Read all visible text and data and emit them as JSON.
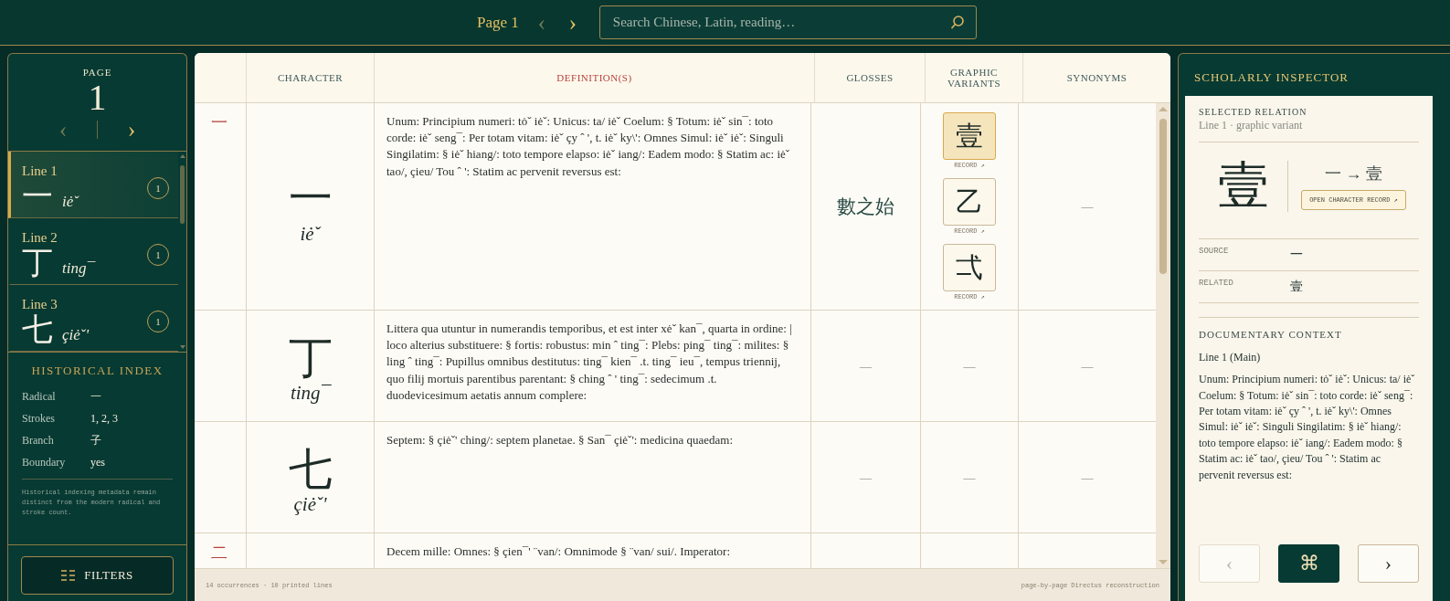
{
  "top_bar": {
    "page_label": "Page 1",
    "prev": {
      "label": "‹",
      "disabled": true
    },
    "next": {
      "label": "›",
      "disabled": false
    },
    "search": {
      "placeholder": "Search Chinese, Latin, reading…"
    }
  },
  "sidebar": {
    "page_caption": "PAGE",
    "page_number": "1",
    "prev": {
      "label": "‹",
      "disabled": true
    },
    "next": {
      "label": "›",
      "disabled": false
    },
    "lines": [
      {
        "label": "Line 1",
        "character": "一",
        "reading": "iėˇ",
        "count": "1",
        "selected": true
      },
      {
        "label": "Line 2",
        "character": "丁",
        "reading": "ting¯",
        "count": "1",
        "selected": false
      },
      {
        "label": "Line 3",
        "character": "七",
        "reading": "çiėˇ'",
        "count": "1",
        "selected": false
      }
    ],
    "index": {
      "title": "HISTORICAL INDEX",
      "fields": [
        {
          "label": "Radical",
          "value": "一"
        },
        {
          "label": "Strokes",
          "value": "1, 2, 3"
        },
        {
          "label": "Branch",
          "value": "子"
        },
        {
          "label": "Boundary",
          "value": "yes"
        }
      ],
      "note": "Historical indexing metadata remain distinct from the modern radical and stroke count."
    },
    "filters_button": "FILTERS"
  },
  "table": {
    "columns": [
      "",
      "CHARACTER",
      "DEFINITION(S)",
      "GLOSSES",
      "GRAPHIC VARIANTS",
      "SYNONYMS"
    ],
    "rows": [
      {
        "marker": "一",
        "character": "一",
        "reading": "iėˇ",
        "definition": "Unum: Principium numeri: tȯˇ iėˇ: Unicus: ta/ iėˇ Coelum: § Totum: iėˇ sin¯: toto corde: iėˇ seng¯: Per totam vitam: iėˇ çy ˆ ', t. iėˇ ky\\': Omnes Simul: iėˇ iėˇ: Singuli Singilatim: § iėˇ hiang/: toto tempore elapso: iėˇ iang/: Eadem modo: § Statim ac: iėˇ tao/, çieu/ Tou ˆ ': Statim ac pervenit reversus est:",
        "gloss": "數之始",
        "variants": [
          {
            "character": "壹",
            "link": "RECORD ↗",
            "selected": true
          },
          {
            "character": "乙",
            "link": "RECORD ↗",
            "selected": false
          },
          {
            "character": "弌",
            "link": "RECORD ↗",
            "selected": false
          }
        ],
        "synonyms": "—"
      },
      {
        "character": "丁",
        "reading": "ting¯",
        "definition": "Littera qua utuntur in numerandis temporibus, et est inter xėˇ kan¯, quarta in ordine: |  loco alterius substituere: § fortis: robustus: min ˆ  ting¯: Plebs: ping¯ ting¯: milites: § ling ˆ  ting¯: Pupillus omnibus destitutus: ting¯ kien¯ .t. ting¯ ieu¯, tempus triennij, quo filij mortuis parentibus parentant: § ching ˆ ' ting¯: sedecimum .t. duodevicesimum aetatis annum complere:",
        "gloss": "—",
        "variants_empty": "—",
        "synonyms": "—"
      },
      {
        "character": "七",
        "reading": "çiėˇ'",
        "definition": "Septem: § çiėˇ' ching/: septem planetae. § San¯ çiėˇ': medicina quaedam:",
        "gloss": "—",
        "variants_empty": "—",
        "synonyms": "—"
      },
      {
        "marker": "二",
        "definition": "Decem mille: Omnes: § çien¯' ¨van/: Omnimode § ¨van/ sui/. Imperator:"
      }
    ],
    "footer_left": "14 occurrences · 10 printed lines",
    "footer_right": "page-by-page Directus reconstruction"
  },
  "inspector": {
    "title": "SCHOLARLY INSPECTOR",
    "relation_caption": "SELECTED RELATION",
    "relation_subtitle": "Line 1 · graphic variant",
    "big_character": "壹",
    "relation": "一 → 壹",
    "open_button": "OPEN CHARACTER RECORD ↗",
    "fields": [
      {
        "label": "SOURCE",
        "value": "一"
      },
      {
        "label": "RELATED",
        "value": "壹"
      }
    ],
    "context_caption": "DOCUMENTARY CONTEXT",
    "context_line": "Line 1 (Main)",
    "context_text": "Unum: Principium numeri: tȯˇ iėˇ: Unicus: ta/ iėˇ Coelum: § Totum: iėˇ sin¯: toto corde: iėˇ seng¯: Per totam vitam: iėˇ çy ˆ ', t. iėˇ ky\\': Omnes Simul: iėˇ iėˇ: Singuli Singilatim: § iėˇ hiang/: toto tempore elapso: iėˇ iang/: Eadem modo: § Statim ac: iėˇ tao/, çieu/ Tou ˆ ': Statim ac pervenit reversus est:",
    "prev": {
      "label": "‹",
      "disabled": true
    },
    "command": "⌘",
    "next": {
      "label": "›",
      "disabled": false
    }
  }
}
